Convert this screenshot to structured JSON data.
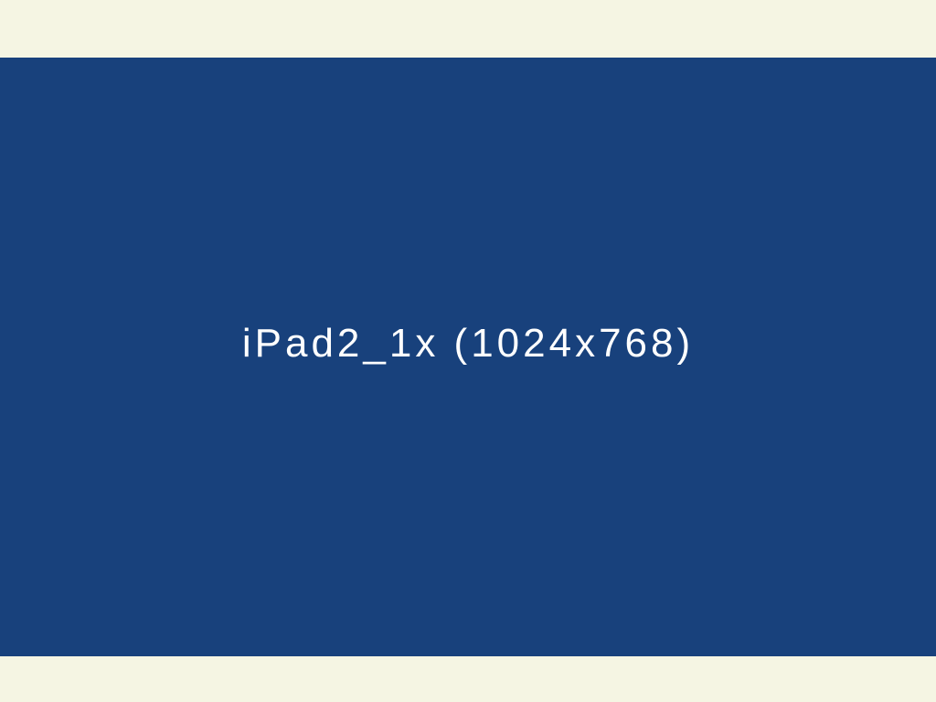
{
  "screen": {
    "label": "iPad2_1x (1024x768)"
  },
  "colors": {
    "background_outer": "#f5f5e3",
    "panel": "#18417c",
    "text": "#ffffff"
  }
}
